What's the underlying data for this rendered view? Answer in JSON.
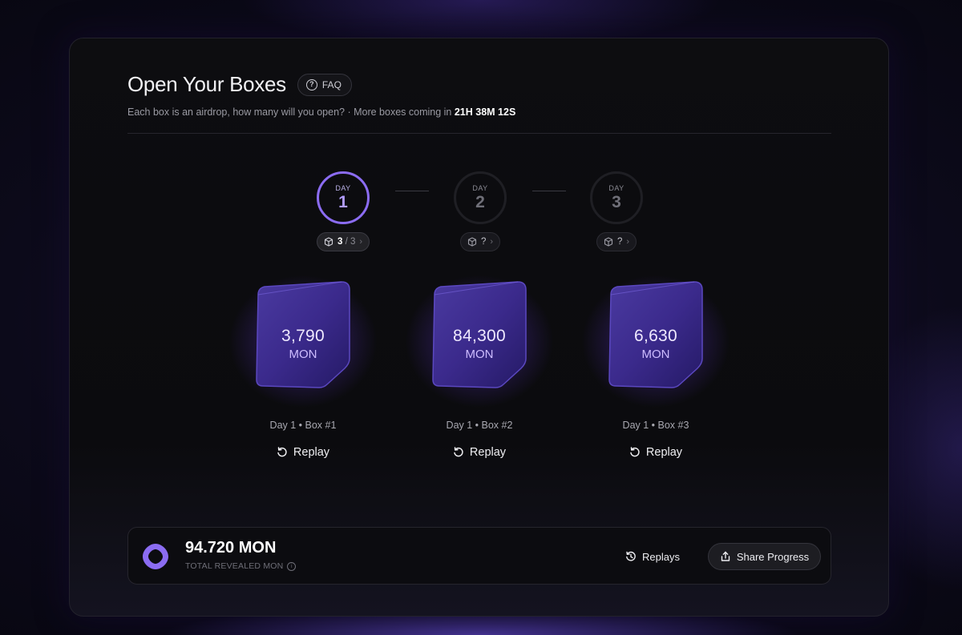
{
  "header": {
    "title": "Open Your Boxes",
    "faq_label": "FAQ",
    "subtitle": "Each box is an airdrop, how many will you open? · More boxes coming in",
    "countdown": "21H 38M 12S"
  },
  "days": [
    {
      "label": "DAY",
      "number": "1",
      "active": true,
      "pill_opened": "3",
      "pill_total": "/ 3"
    },
    {
      "label": "DAY",
      "number": "2",
      "active": false,
      "pill_text": "?"
    },
    {
      "label": "DAY",
      "number": "3",
      "active": false,
      "pill_text": "?"
    }
  ],
  "boxes": [
    {
      "value": "3,790",
      "unit": "MON",
      "caption": "Day 1 • Box #1",
      "replay_label": "Replay"
    },
    {
      "value": "84,300",
      "unit": "MON",
      "caption": "Day 1 • Box #2",
      "replay_label": "Replay"
    },
    {
      "value": "6,630",
      "unit": "MON",
      "caption": "Day 1 • Box #3",
      "replay_label": "Replay"
    }
  ],
  "footer": {
    "total_value": "94.720 MON",
    "total_label": "TOTAL REVEALED MON",
    "replays_label": "Replays",
    "share_label": "Share Progress"
  },
  "colors": {
    "accent": "#8b6cf2",
    "box_purple": "#3a2a8a",
    "background": "#0b0b0e"
  },
  "icons": {
    "faq": "question-circle-icon",
    "pill": "cube-icon",
    "replay": "rotate-ccw-icon",
    "replays": "history-icon",
    "share": "share-icon",
    "logo": "monad-logo-icon",
    "info": "info-icon"
  }
}
